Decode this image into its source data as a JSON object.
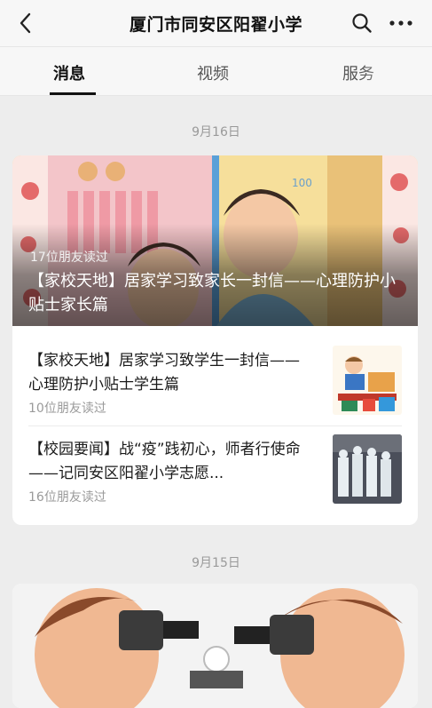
{
  "header": {
    "title": "厦门市同安区阳翟小学",
    "back_icon": "back-chevron-icon",
    "search_icon": "search-icon",
    "more_icon": "more-dots-icon"
  },
  "tabs": [
    {
      "label": "消息",
      "active": true
    },
    {
      "label": "视频",
      "active": false
    },
    {
      "label": "服务",
      "active": false
    }
  ],
  "feed": [
    {
      "date": "9月16日",
      "hero": {
        "read_count": "17位朋友读过",
        "title": "【家校天地】居家学习致家长一封信——心理防护小贴士家长篇"
      },
      "items": [
        {
          "title": "【家校天地】居家学习致学生一封信——心理防护小贴士学生篇",
          "read_count": "10位朋友读过"
        },
        {
          "title": "【校园要闻】战“疫”践初心，师者行使命——记同安区阳翟小学志愿...",
          "read_count": "16位朋友读过"
        }
      ]
    },
    {
      "date": "9月15日"
    }
  ],
  "colors": {
    "background": "#ededed",
    "card": "#ffffff",
    "secondary_text": "#9a9a9a"
  }
}
